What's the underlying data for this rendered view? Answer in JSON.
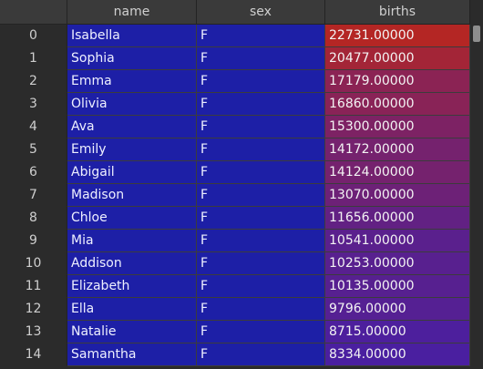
{
  "table": {
    "columns": {
      "index": "",
      "name": "name",
      "sex": "sex",
      "births": "births"
    },
    "births_color_scale": {
      "high": "#b42624",
      "low": "#4a1fa0"
    },
    "rows": [
      {
        "index": "0",
        "name": "Isabella",
        "sex": "F",
        "births": "22731.00000"
      },
      {
        "index": "1",
        "name": "Sophia",
        "sex": "F",
        "births": "20477.00000"
      },
      {
        "index": "2",
        "name": "Emma",
        "sex": "F",
        "births": "17179.00000"
      },
      {
        "index": "3",
        "name": "Olivia",
        "sex": "F",
        "births": "16860.00000"
      },
      {
        "index": "4",
        "name": "Ava",
        "sex": "F",
        "births": "15300.00000"
      },
      {
        "index": "5",
        "name": "Emily",
        "sex": "F",
        "births": "14172.00000"
      },
      {
        "index": "6",
        "name": "Abigail",
        "sex": "F",
        "births": "14124.00000"
      },
      {
        "index": "7",
        "name": "Madison",
        "sex": "F",
        "births": "13070.00000"
      },
      {
        "index": "8",
        "name": "Chloe",
        "sex": "F",
        "births": "11656.00000"
      },
      {
        "index": "9",
        "name": "Mia",
        "sex": "F",
        "births": "10541.00000"
      },
      {
        "index": "10",
        "name": "Addison",
        "sex": "F",
        "births": "10253.00000"
      },
      {
        "index": "11",
        "name": "Elizabeth",
        "sex": "F",
        "births": "10135.00000"
      },
      {
        "index": "12",
        "name": "Ella",
        "sex": "F",
        "births": "9796.00000"
      },
      {
        "index": "13",
        "name": "Natalie",
        "sex": "F",
        "births": "8715.00000"
      },
      {
        "index": "14",
        "name": "Samantha",
        "sex": "F",
        "births": "8334.00000"
      }
    ]
  }
}
